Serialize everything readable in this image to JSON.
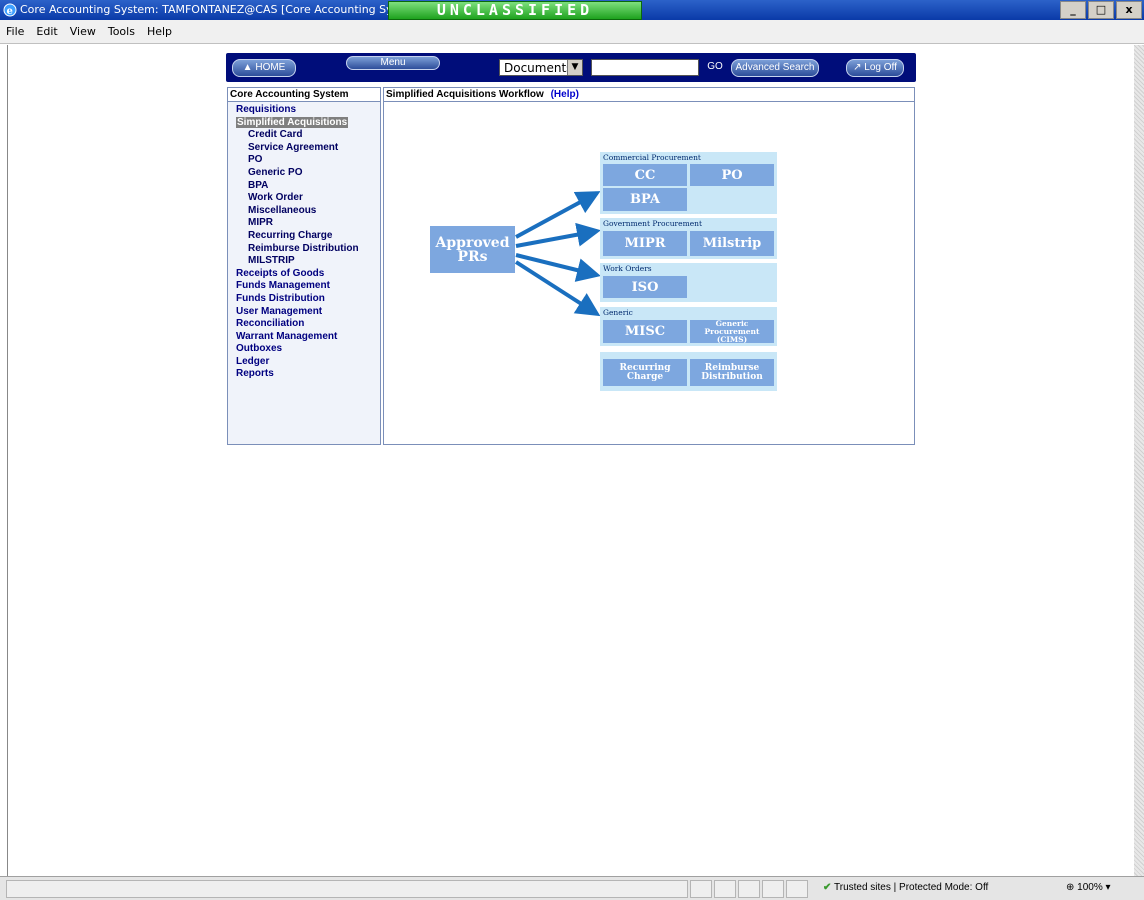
{
  "window": {
    "title": "Core Accounting System: TAMFONTANEZ@CAS [Core Accounting System] - W",
    "classification": "UNCLASSIFIED",
    "buttons": {
      "minimize": "_",
      "maximize": "□",
      "close": "x"
    }
  },
  "menubar": {
    "items": [
      "File",
      "Edit",
      "View",
      "Tools",
      "Help"
    ]
  },
  "appnav": {
    "home_label": "HOME",
    "menu_label": "Menu",
    "documents_select": "Documents",
    "search_value": "",
    "go_label": "GO",
    "advanced_search_label": "Advanced Search",
    "logoff_label": "Log Off"
  },
  "sidebar": {
    "title": "Core Accounting System",
    "items": [
      {
        "label": "Requisitions"
      },
      {
        "label": "Simplified Acquisitions"
      },
      {
        "label": "Credit Card"
      },
      {
        "label": "Service Agreement"
      },
      {
        "label": "PO"
      },
      {
        "label": "Generic PO"
      },
      {
        "label": "BPA"
      },
      {
        "label": "Work Order"
      },
      {
        "label": "Miscellaneous"
      },
      {
        "label": "MIPR"
      },
      {
        "label": "Recurring Charge"
      },
      {
        "label": "Reimburse Distribution"
      },
      {
        "label": "MILSTRIP"
      },
      {
        "label": "Receipts of Goods"
      },
      {
        "label": "Funds Management"
      },
      {
        "label": "Funds Distribution"
      },
      {
        "label": "User Management"
      },
      {
        "label": "Reconciliation"
      },
      {
        "label": "Warrant Management"
      },
      {
        "label": "Outboxes"
      },
      {
        "label": "Ledger"
      },
      {
        "label": "Reports"
      }
    ]
  },
  "panel": {
    "title": "Simplified Acquisitions Workflow",
    "help_label": "(Help)"
  },
  "workflow": {
    "source": {
      "line1": "Approved",
      "line2": "PRs"
    },
    "groups": {
      "commercial": {
        "label": "Commercial Procurement",
        "tiles": [
          "CC",
          "PO",
          "BPA"
        ]
      },
      "government": {
        "label": "Government Procurement",
        "tiles": [
          "MIPR",
          "Milstrip"
        ]
      },
      "work_orders": {
        "label": "Work Orders",
        "tiles": [
          "ISO"
        ]
      },
      "generic": {
        "label": "Generic",
        "tile_misc": "MISC",
        "tile_cims_1": "Generic",
        "tile_cims_2": "Procurement (CIMS)"
      },
      "other": {
        "rc1": "Recurring",
        "rc2": "Charge",
        "rd1": "Reimburse",
        "rd2": "Distribution"
      }
    },
    "colors": {
      "tile": "#7da7df",
      "group_bg": "#c9e7f7",
      "arrow": "#1a6fbf"
    }
  },
  "statusbar": {
    "zone": "Trusted sites | Protected Mode: Off",
    "zoom": "100%"
  }
}
